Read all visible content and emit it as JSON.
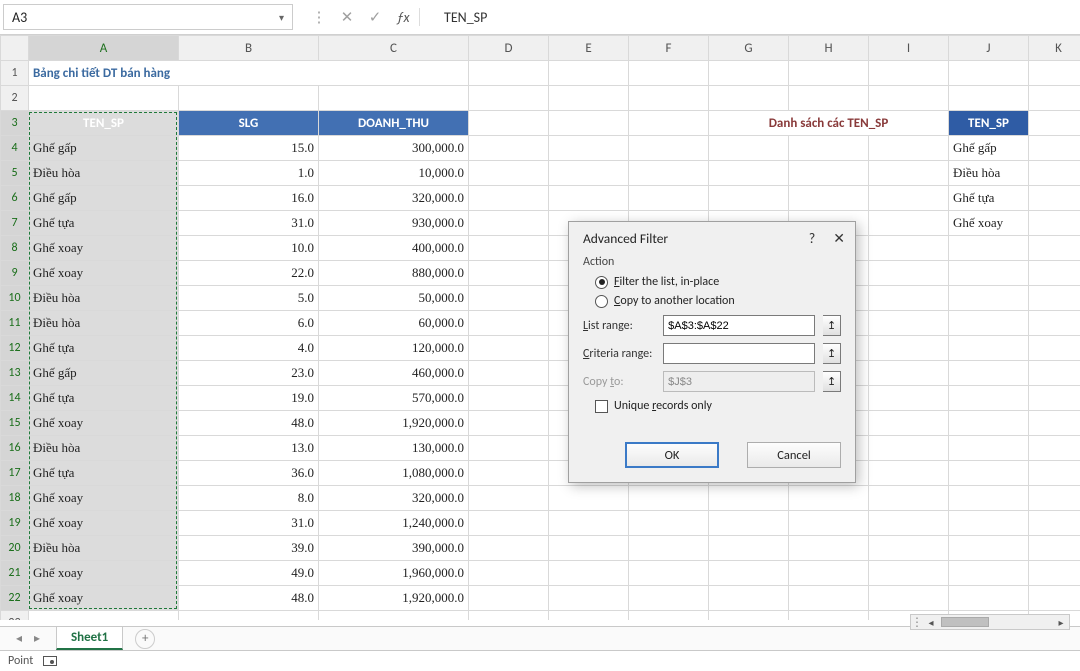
{
  "nameBox": "A3",
  "formulaBarValue": "TEN_SP",
  "columns": [
    "",
    "A",
    "B",
    "C",
    "D",
    "E",
    "F",
    "G",
    "H",
    "I",
    "J",
    "K"
  ],
  "title": "Bảng chi tiết DT bán hàng",
  "tableHeaders": {
    "a": "TEN_SP",
    "b": "SLG",
    "c": "DOANH_THU"
  },
  "danhSachLabel": "Danh sách các TEN_SP",
  "jHeader": "TEN_SP",
  "data": [
    {
      "name": "Ghế gấp",
      "slg": "15.0",
      "dt": "300,000.0"
    },
    {
      "name": "Điều hòa",
      "slg": "1.0",
      "dt": "10,000.0"
    },
    {
      "name": "Ghế gấp",
      "slg": "16.0",
      "dt": "320,000.0"
    },
    {
      "name": "Ghế tựa",
      "slg": "31.0",
      "dt": "930,000.0"
    },
    {
      "name": "Ghế xoay",
      "slg": "10.0",
      "dt": "400,000.0"
    },
    {
      "name": "Ghế xoay",
      "slg": "22.0",
      "dt": "880,000.0"
    },
    {
      "name": "Điều hòa",
      "slg": "5.0",
      "dt": "50,000.0"
    },
    {
      "name": "Điều hòa",
      "slg": "6.0",
      "dt": "60,000.0"
    },
    {
      "name": "Ghế tựa",
      "slg": "4.0",
      "dt": "120,000.0"
    },
    {
      "name": "Ghế gấp",
      "slg": "23.0",
      "dt": "460,000.0"
    },
    {
      "name": "Ghế tựa",
      "slg": "19.0",
      "dt": "570,000.0"
    },
    {
      "name": "Ghế xoay",
      "slg": "48.0",
      "dt": "1,920,000.0"
    },
    {
      "name": "Điều hòa",
      "slg": "13.0",
      "dt": "130,000.0"
    },
    {
      "name": "Ghế tựa",
      "slg": "36.0",
      "dt": "1,080,000.0"
    },
    {
      "name": "Ghế xoay",
      "slg": "8.0",
      "dt": "320,000.0"
    },
    {
      "name": "Ghế xoay",
      "slg": "31.0",
      "dt": "1,240,000.0"
    },
    {
      "name": "Điều hòa",
      "slg": "39.0",
      "dt": "390,000.0"
    },
    {
      "name": "Ghế xoay",
      "slg": "49.0",
      "dt": "1,960,000.0"
    },
    {
      "name": "Ghế xoay",
      "slg": "48.0",
      "dt": "1,920,000.0"
    }
  ],
  "unique": [
    "Ghế gấp",
    "Điều hòa",
    "Ghế tựa",
    "Ghế xoay"
  ],
  "dialog": {
    "title": "Advanced Filter",
    "helpGlyph": "?",
    "closeGlyph": "✕",
    "actionLabel": "Action",
    "optFilterPrefix": "F",
    "optFilter": "ilter the list, in-place",
    "optCopyPrefix": "C",
    "optCopy": "opy to another location",
    "listRangePrefix": "L",
    "listRange": "ist range:",
    "listRangeValue": "$A$3:$A$22",
    "criteriaRangePrefix": "C",
    "criteriaRange": "riteria range:",
    "criteriaValue": "",
    "copyToPrefix": "t",
    "copyToBefore": "Copy ",
    "copyToAfter": "o:",
    "copyToValue": "$J$3",
    "uniquePrefix": "r",
    "uniqueBefore": "Unique ",
    "uniqueAfter": "ecords only",
    "ok": "OK",
    "cancel": "Cancel",
    "rangeGlyph": "↥"
  },
  "sheetTab": "Sheet1",
  "status": "Point"
}
